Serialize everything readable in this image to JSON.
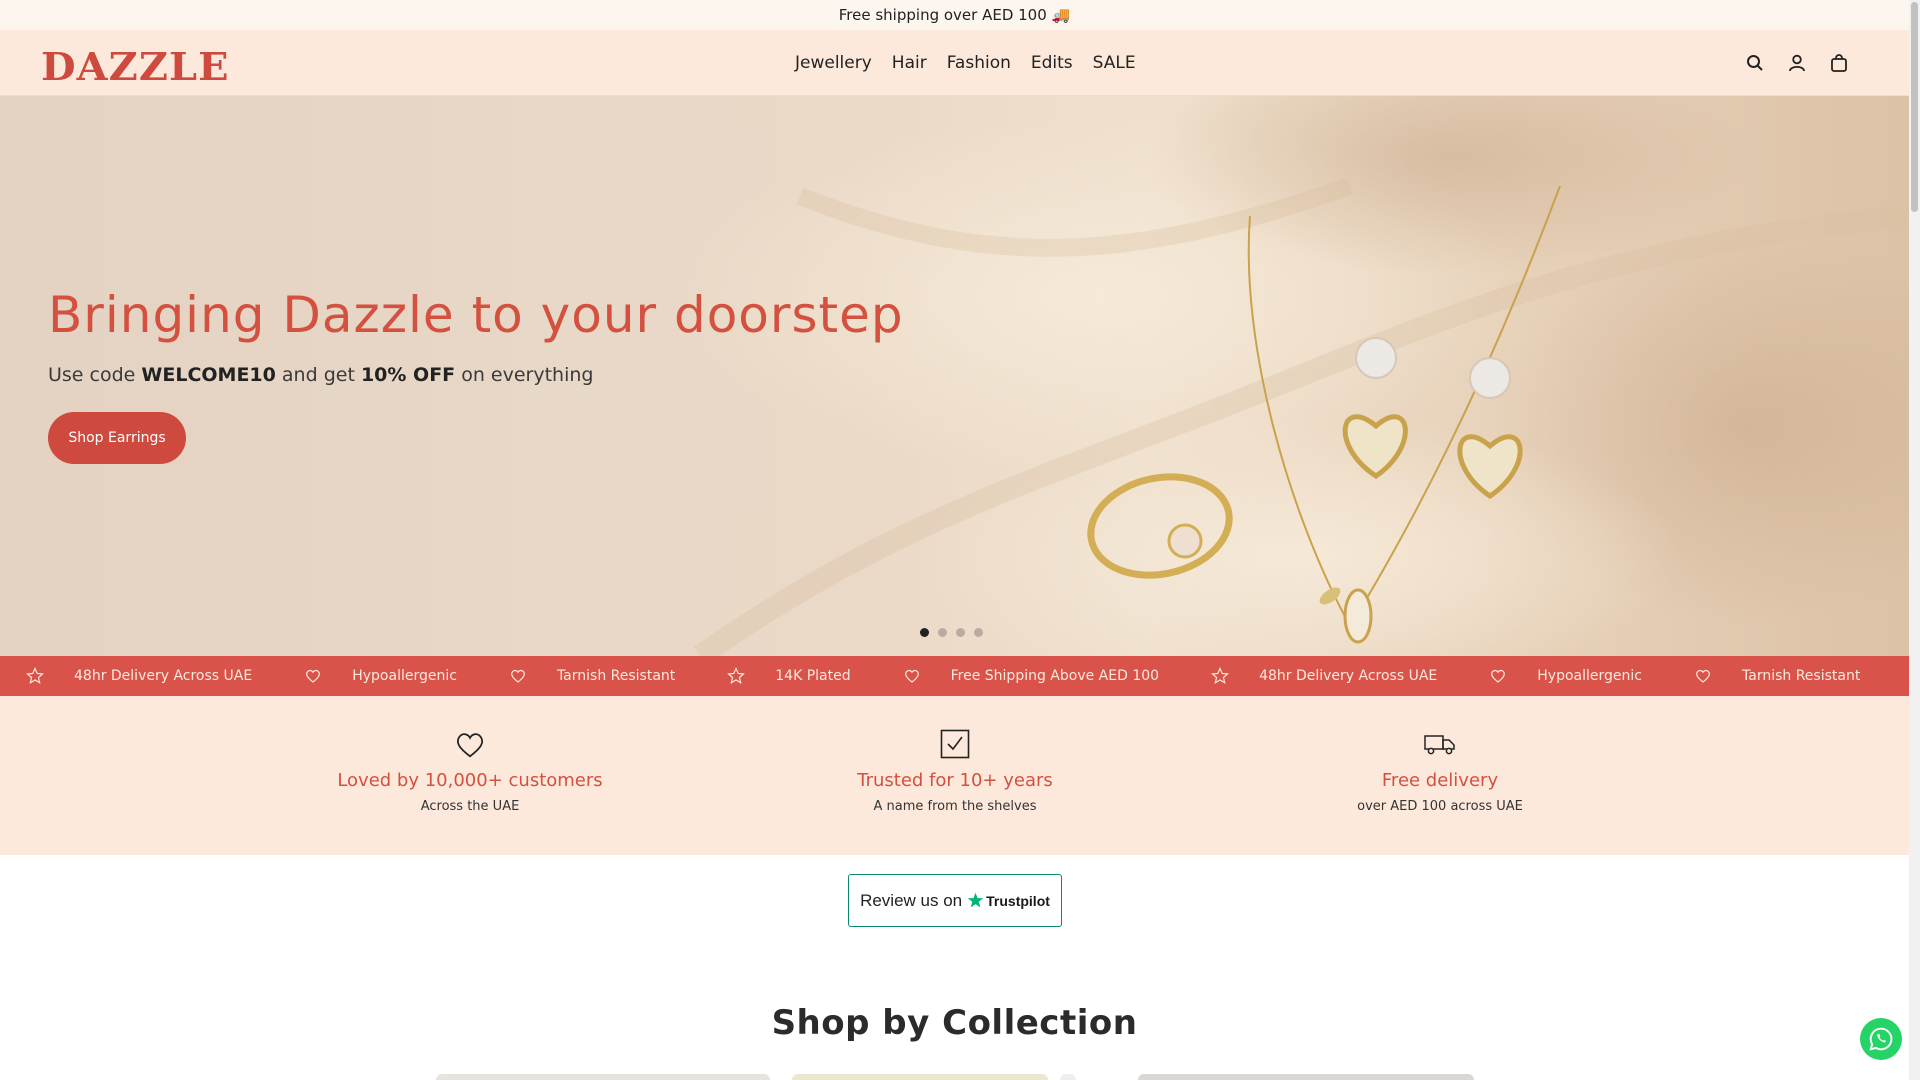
{
  "announcement": {
    "text": "Free shipping over AED 100 🚚"
  },
  "brand": {
    "logo_text": "DAZZLE",
    "accent_color": "#cf4a3e"
  },
  "nav": {
    "items": [
      {
        "label": "Jewellery"
      },
      {
        "label": "Hair"
      },
      {
        "label": "Fashion"
      },
      {
        "label": "Edits"
      },
      {
        "label": "SALE"
      }
    ]
  },
  "header_icons": [
    "search-icon",
    "account-icon",
    "bag-icon"
  ],
  "hero": {
    "title": "Bringing Dazzle to your doorstep",
    "sub_prefix": "Use code ",
    "code": "WELCOME10",
    "sub_mid": " and get ",
    "discount": "10% OFF",
    "sub_suffix": " on everything",
    "button_label": "Shop Earrings",
    "slides_count": 4,
    "active_slide": 1
  },
  "marquee": {
    "items": [
      {
        "icon": "star-icon",
        "text": "48hr Delivery Across UAE"
      },
      {
        "icon": "heart-icon",
        "text": "Hypoallergenic"
      },
      {
        "icon": "heart-icon",
        "text": "Tarnish Resistant"
      },
      {
        "icon": "star-icon",
        "text": "14K Plated"
      },
      {
        "icon": "heart-icon",
        "text": "Free Shipping Above AED 100"
      },
      {
        "icon": "star-icon",
        "text": "48hr Delivery Across UAE"
      },
      {
        "icon": "heart-icon",
        "text": "Hypoallergenic"
      },
      {
        "icon": "heart-icon",
        "text": "Tarnish Resistant"
      },
      {
        "icon": "star-icon",
        "text": ""
      }
    ]
  },
  "features": [
    {
      "icon": "heart-icon",
      "title": "Loved by 10,000+ customers",
      "subtitle": "Across the UAE"
    },
    {
      "icon": "checkbox-icon",
      "title": "Trusted for 10+ years",
      "subtitle": "A name from the shelves"
    },
    {
      "icon": "truck-icon",
      "title": "Free delivery",
      "subtitle": "over AED 100 across UAE"
    }
  ],
  "trustpilot": {
    "review_label": "Review us on",
    "brand": "Trustpilot"
  },
  "collection": {
    "title": "Shop by Collection"
  }
}
